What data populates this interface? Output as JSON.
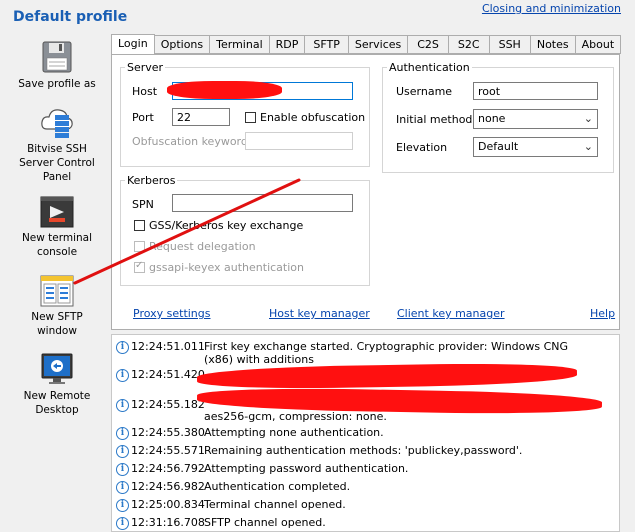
{
  "window": {
    "title": "Default profile",
    "top_link": "Closing and minimization"
  },
  "sidebar": {
    "items": [
      {
        "label": "Save profile as",
        "icon": "floppy-disk-icon"
      },
      {
        "label": "Bitvise SSH Server Control Panel",
        "icon": "server-cloud-icon"
      },
      {
        "label": "New terminal console",
        "icon": "terminal-icon"
      },
      {
        "label": "New SFTP window",
        "icon": "sftp-window-icon"
      },
      {
        "label": "New Remote Desktop",
        "icon": "remote-desktop-icon"
      }
    ]
  },
  "tabs": [
    "Login",
    "Options",
    "Terminal",
    "RDP",
    "SFTP",
    "Services",
    "C2S",
    "S2C",
    "SSH",
    "Notes",
    "About"
  ],
  "active_tab": "Login",
  "server": {
    "legend": "Server",
    "host_label": "Host",
    "host_value": "",
    "port_label": "Port",
    "port_value": "22",
    "obfuscation_label": "Enable obfuscation",
    "obfuscation_keyword_label": "Obfuscation keyword"
  },
  "authentication": {
    "legend": "Authentication",
    "username_label": "Username",
    "username_value": "root",
    "method_label": "Initial method",
    "method_value": "none",
    "elevation_label": "Elevation",
    "elevation_value": "Default"
  },
  "kerberos": {
    "legend": "Kerberos",
    "spn_label": "SPN",
    "gss_label": "GSS/Kerberos key exchange",
    "delegation_label": "Request delegation",
    "gssapi_label": "gssapi-keyex authentication"
  },
  "links": {
    "proxy": "Proxy settings",
    "host_key": "Host key manager",
    "client_key": "Client key manager",
    "help": "Help"
  },
  "log": [
    {
      "time": "12:24:51.011",
      "message": "First key exchange started. Cryptographic provider: Windows CNG (x86) with additions"
    },
    {
      "time": "12:24:51.420",
      "message": ""
    },
    {
      "time": "12:24:55.182",
      "message": "aes256-gcm, compression: none."
    },
    {
      "time": "12:24:55.380",
      "message": "Attempting none authentication."
    },
    {
      "time": "12:24:55.571",
      "message": "Remaining authentication methods: 'publickey,password'."
    },
    {
      "time": "12:24:56.792",
      "message": "Attempting password authentication."
    },
    {
      "time": "12:24:56.982",
      "message": "Authentication completed."
    },
    {
      "time": "12:25:00.834",
      "message": "Terminal channel opened."
    },
    {
      "time": "12:31:16.708",
      "message": "SFTP channel opened."
    }
  ]
}
